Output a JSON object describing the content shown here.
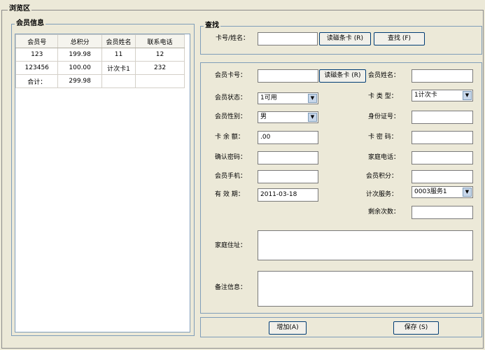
{
  "window": {
    "title": "浏览区"
  },
  "member_panel": {
    "legend": "会员信息",
    "columns": [
      "会员号",
      "总积分",
      "会员姓名",
      "联系电话"
    ],
    "rows": [
      [
        "123",
        "199.98",
        "11",
        "12"
      ],
      [
        "123456",
        "100.00",
        "计次卡1",
        "232"
      ],
      [
        "合计：",
        "299.98",
        "",
        ""
      ]
    ]
  },
  "search": {
    "legend": "查找",
    "label": "卡号/姓名：",
    "value": "",
    "read_card_label": "读磁条卡 (R)",
    "find_label": "查找 (F)"
  },
  "form": {
    "card_no_label": "会员卡号：",
    "card_no_value": "",
    "read_card_label": "读磁条卡 (R)",
    "name_label": "会员姓名：",
    "name_value": "",
    "status_label": "会员状态：",
    "status_value": "1可用",
    "card_type_label": "卡 类 型：",
    "card_type_value": "1计次卡",
    "gender_label": "会员性别：",
    "gender_value": "男",
    "id_label": "身份证号：",
    "id_value": "",
    "balance_label": "卡 余 额：",
    "balance_value": ".00",
    "password_label": "卡 密 码：",
    "password_value": "",
    "confirm_label": "确认密码：",
    "confirm_value": "",
    "home_phone_label": "家庭电话：",
    "home_phone_value": "",
    "mobile_label": "会员手机：",
    "mobile_value": "",
    "points_label": "会员积分：",
    "points_value": "",
    "expiry_label": "有 效 期：",
    "expiry_value": "2011-03-18",
    "service_label": "计次服务：",
    "service_value": "0003服务1",
    "remaining_label": "剩余次数：",
    "remaining_value": "",
    "address_label": "家庭住址：",
    "address_value": "",
    "notes_label": "备注信息：",
    "notes_value": ""
  },
  "actions": {
    "add_label": "增加(A)",
    "save_label": "保存 (S)"
  },
  "icons": {
    "dropdown": "chevron-down-icon"
  }
}
